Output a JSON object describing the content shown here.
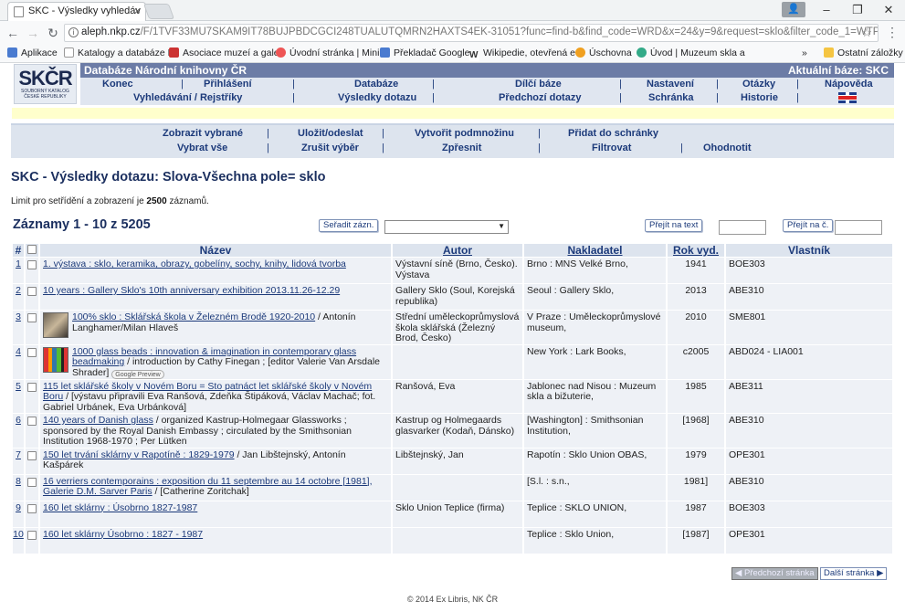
{
  "browser": {
    "tab_title": "SKC - Výsledky vyhledáv",
    "url_host": "aleph.nkp.cz",
    "url_rest": "/F/1TVF33MU7SKAM9IT78BUJPBDCGCI248TUALUTQMRN2HAXTS4EK-31051?func=find-b&find_code=WRD&x=24&y=9&request=sklo&filter_code_1=WTP&filter_re",
    "bookmarks": [
      {
        "label": "Aplikace",
        "color": "#4a7bd0"
      },
      {
        "label": "Katalogy a databáze N",
        "color": "#9aa"
      },
      {
        "label": "Asociace muzeí a gale",
        "color": "#c33"
      },
      {
        "label": "Úvodní stránka | Mini",
        "color": "#e55"
      },
      {
        "label": "Překladač Google",
        "color": "#4a7bd0"
      },
      {
        "label": "Wikipedie, otevřená e",
        "color": "#333"
      },
      {
        "label": "Úschovna",
        "color": "#f0a020"
      },
      {
        "label": "Úvod | Muzeum skla a",
        "color": "#3a8"
      },
      {
        "label": "Ostatní záložky",
        "color": "#f5c542"
      }
    ],
    "more_bookmarks": "»"
  },
  "header": {
    "logo_text": "SKČR",
    "logo_sub": "SOUBORNÝ KATALOG ČESKÉ REPUBLIKY",
    "db_title": "Databáze Národní knihovny ČR",
    "current_base": "Aktuální báze:  SKC",
    "nav1": [
      "Konec",
      "Přihlášení",
      "Databáze",
      "Dílčí báze",
      "Nastavení",
      "Otázky",
      "Nápověda"
    ],
    "nav2": [
      "Vyhledávání / Rejstříky",
      "Výsledky dotazu",
      "Předchozí dotazy",
      "Schránka",
      "Historie"
    ]
  },
  "actions": {
    "row1": [
      "Zobrazit vybrané",
      "Uložit/odeslat",
      "Vytvořit podmnožinu",
      "Přidat do schránky"
    ],
    "row2": [
      "Vybrat vše",
      "Zrušit výběr",
      "Zpřesnit",
      "Filtrovat",
      "Ohodnotit"
    ]
  },
  "results": {
    "title": "SKC - Výsledky dotazu:  Slova-Všechna pole= sklo",
    "limit_pre": "Limit pro setřídění a zobrazení je ",
    "limit_num": "2500",
    "limit_post": " záznamů.",
    "records_label": "Záznamy 1 - 10 z 5205",
    "sort_button": "Seřadit zázn.",
    "goto_text_button": "Přejít na text",
    "goto_num_button": "Přejít na č.",
    "columns": [
      "#",
      "",
      "Název",
      "Autor",
      "Nakladatel",
      "Rok vyd.",
      "Vlastník"
    ],
    "rows": [
      {
        "num": "1",
        "title": "1. výstava : sklo, keramika, obrazy, gobelíny, sochy, knihy, lidová tvorba",
        "rest": "",
        "author": "Výstavní síně (Brno, Česko). Výstava",
        "publisher": "Brno : MNS Velké Brno,",
        "year": "1941",
        "owner": "BOE303",
        "thumb": ""
      },
      {
        "num": "2",
        "title": "10 years : Gallery Sklo's 10th anniversary exhibition 2013.11.26-12.29",
        "rest": "",
        "author": "Gallery Sklo (Soul, Korejská republika)",
        "publisher": "Seoul : Gallery Sklo,",
        "year": "2013",
        "owner": "ABE310",
        "thumb": ""
      },
      {
        "num": "3",
        "title": "100% sklo : Sklářská škola v Železném Brodě 1920-2010",
        "rest": " / Antonín Langhamer/Milan Hlaveš",
        "author": "Střední uměleckoprůmyslová škola sklářská (Železný Brod, Česko)",
        "publisher": "V Praze : Uměleckoprůmyslové museum,",
        "year": "2010",
        "owner": "SME801",
        "thumb": "a"
      },
      {
        "num": "4",
        "title": "1000 glass beads : innovation & imagination in contemporary glass beadmaking",
        "rest": " / introduction by Cathy Finegan ; [editor Valerie Van Arsdale Shrader]",
        "author": "",
        "publisher": "New York : Lark Books,",
        "year": "c2005",
        "owner": "ABD024 - LIA001",
        "thumb": "b",
        "gpreview": "Google Preview"
      },
      {
        "num": "5",
        "title": "115 let sklářské školy v Novém Boru = Sto patnáct let sklářské školy v Novém Boru",
        "rest": " / [výstavu připravili Eva Ranšová, Zdeňka Štipáková, Václav Machač; fot. Gabriel Urbánek, Eva Urbánková]",
        "author": "Ranšová, Eva",
        "publisher": "Jablonec nad Nisou : Muzeum skla a bižuterie,",
        "year": "1985",
        "owner": "ABE311",
        "thumb": ""
      },
      {
        "num": "6",
        "title": "140 years of Danish glass",
        "rest": " / organized Kastrup-Holmegaar Glassworks ; sponsored by the Royal Danish Embassy ; circulated by the Smithsonian Institution 1968-1970 ; Per Lütken",
        "author": "Kastrup og Holmegaards glasvarker (Kodaň, Dánsko)",
        "publisher": "[Washington] : Smithsonian Institution,",
        "year": "[1968]",
        "owner": "ABE310",
        "thumb": ""
      },
      {
        "num": "7",
        "title": "150 let trvání sklárny v Rapotíně : 1829-1979",
        "rest": " / Jan Libštejnský, Antonín Kašpárek",
        "author": "Libštejnský, Jan",
        "publisher": "Rapotín : Sklo Union OBAS,",
        "year": "1979",
        "owner": "OPE301",
        "thumb": ""
      },
      {
        "num": "8",
        "title": "16 verriers contemporains : exposition du 11 septembre au 14 octobre [1981], Galerie D.M. Sarver Paris",
        "rest": " / [Catherine Zoritchak]",
        "author": "",
        "publisher": "[S.l. : s.n.,",
        "year": "1981]",
        "owner": "ABE310",
        "thumb": ""
      },
      {
        "num": "9",
        "title": "160 let sklárny : Úsobrno 1827-1987",
        "rest": "",
        "author": "Sklo Union Teplice (firma)",
        "publisher": "Teplice : SKLO UNION,",
        "year": "1987",
        "owner": "BOE303",
        "thumb": ""
      },
      {
        "num": "10",
        "title": "160 let sklárny Úsobrno : 1827 - 1987",
        "rest": "",
        "author": "",
        "publisher": "Teplice : Sklo Union,",
        "year": "[1987]",
        "owner": "OPE301",
        "thumb": ""
      }
    ]
  },
  "pager": {
    "prev": "◀ Předchozí stránka",
    "next": "Další stránka ▶"
  },
  "footer": "© 2014 Ex Libris, NK ČR"
}
